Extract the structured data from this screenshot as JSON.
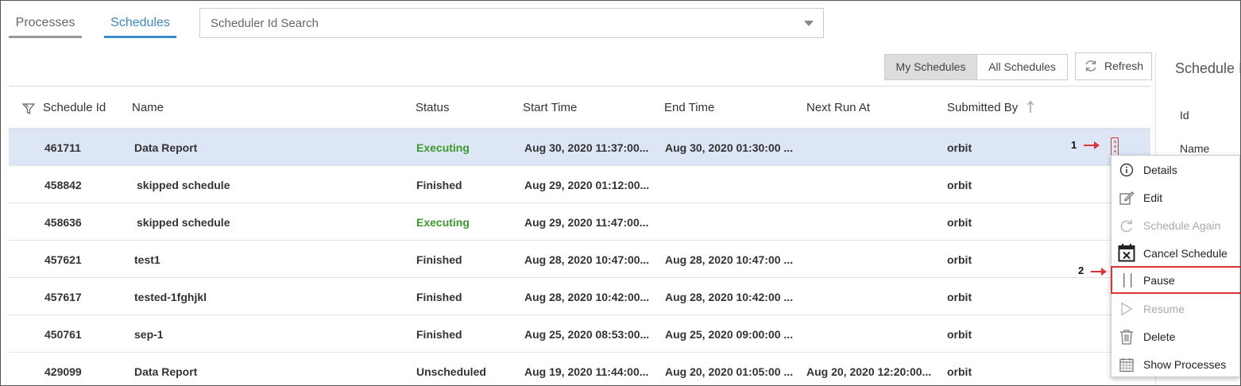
{
  "tabs": {
    "processes": "Processes",
    "schedules": "Schedules"
  },
  "search": {
    "placeholder": "Scheduler Id Search"
  },
  "toolbar": {
    "my_schedules": "My Schedules",
    "all_schedules": "All Schedules",
    "refresh": "Refresh"
  },
  "table": {
    "headers": {
      "schedule_id": "Schedule Id",
      "name": "Name",
      "status": "Status",
      "start_time": "Start Time",
      "end_time": "End Time",
      "next_run_at": "Next Run At",
      "submitted_by": "Submitted By"
    },
    "rows": [
      {
        "id": "461711",
        "name": "Data Report",
        "status": "Executing",
        "start": "Aug 30, 2020 11:37:00...",
        "end": "Aug 30, 2020 01:30:00 ...",
        "next": "",
        "by": "orbit"
      },
      {
        "id": "458842",
        "name": "skipped schedule",
        "status": "Finished",
        "start": "Aug 29, 2020 01:12:00...",
        "end": "",
        "next": "",
        "by": "orbit"
      },
      {
        "id": "458636",
        "name": "skipped schedule",
        "status": "Executing",
        "start": "Aug 29, 2020 11:47:00...",
        "end": "",
        "next": "",
        "by": "orbit"
      },
      {
        "id": "457621",
        "name": "test1",
        "status": "Finished",
        "start": "Aug 28, 2020 10:47:00...",
        "end": "Aug 28, 2020 10:47:00 ...",
        "next": "",
        "by": "orbit"
      },
      {
        "id": "457617",
        "name": "tested-1fghjkl",
        "status": "Finished",
        "start": "Aug 28, 2020 10:42:00...",
        "end": "Aug 28, 2020 10:42:00 ...",
        "next": "",
        "by": "orbit"
      },
      {
        "id": "450761",
        "name": "sep-1",
        "status": "Finished",
        "start": "Aug 25, 2020 08:53:00...",
        "end": "Aug 25, 2020 09:00:00 ...",
        "next": "",
        "by": "orbit"
      },
      {
        "id": "429099",
        "name": "Data Report",
        "status": "Unscheduled",
        "start": "Aug 19, 2020 11:44:00...",
        "end": "Aug 20, 2020 01:05:00 ...",
        "next": "Aug 20, 2020 12:20:00...",
        "by": "orbit"
      }
    ]
  },
  "right_panel": {
    "title": "Schedule I",
    "id_label": "Id",
    "name_label": "Name"
  },
  "annotations": {
    "marker1": "1",
    "marker2": "2"
  },
  "context_menu": {
    "items": [
      {
        "label": "Details",
        "icon": "info-icon",
        "disabled": false
      },
      {
        "label": "Edit",
        "icon": "edit-icon",
        "disabled": false
      },
      {
        "label": "Schedule Again",
        "icon": "redo-icon",
        "disabled": true
      },
      {
        "label": "Cancel Schedule",
        "icon": "calendar-x-icon",
        "disabled": false
      },
      {
        "label": "Pause",
        "icon": "pause-icon",
        "disabled": false
      },
      {
        "label": "Resume",
        "icon": "play-icon",
        "disabled": true
      },
      {
        "label": "Delete",
        "icon": "trash-icon",
        "disabled": false
      },
      {
        "label": "Show Processes",
        "icon": "calendar-grid-icon",
        "disabled": false
      }
    ]
  },
  "colors": {
    "accent": "#3b8bc9",
    "executing": "#3a9a2a",
    "selected_row": "#dde6f5",
    "annotation": "#dd3333"
  }
}
